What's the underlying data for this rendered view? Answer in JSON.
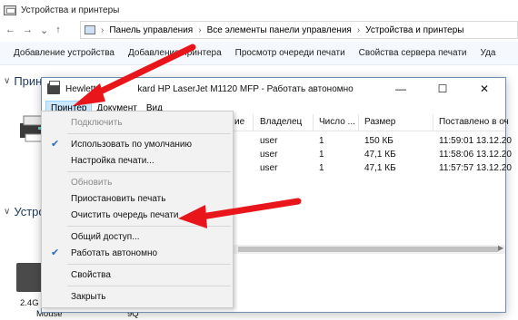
{
  "bg": {
    "title": "Устройства и принтеры",
    "breadcrumb": [
      "Панель управления",
      "Все элементы панели управления",
      "Устройства и принтеры"
    ],
    "toolbar": [
      "Добавление устройства",
      "Добавление принтера",
      "Просмотр очереди печати",
      "Свойства сервера печати",
      "Уда"
    ],
    "section_printers": "Принт",
    "section_devices": "Устро",
    "device1_line1": "2.4G K",
    "device1_line2": "Mouse",
    "device2_line": "9Q"
  },
  "win": {
    "title_a": "Hewlett",
    "title_b": "kard HP LaserJet M1120 MFP  -  Работать автономно",
    "min": "—",
    "max": "☐",
    "close": "✕",
    "menus": [
      "Принтер",
      "Документ",
      "Вид"
    ],
    "columns": [
      "ие",
      "Владелец",
      "Число ...",
      "Размер",
      "Поставлено в оч"
    ],
    "rows": [
      {
        "owner": "user",
        "count": "1",
        "size": "150 КБ",
        "queued": "11:59:01  13.12.20"
      },
      {
        "owner": "user",
        "count": "1",
        "size": "47,1 КБ",
        "queued": "11:58:06  13.12.20"
      },
      {
        "owner": "user",
        "count": "1",
        "size": "47,1 КБ",
        "queued": "11:57:57  13.12.20"
      }
    ]
  },
  "menu": {
    "items": [
      {
        "label": "Подключить",
        "disabled": true,
        "checked": false
      },
      {
        "label": "Использовать по умолчанию",
        "disabled": false,
        "checked": true
      },
      {
        "label": "Настройка печати...",
        "disabled": false,
        "checked": false
      },
      {
        "label": "Обновить",
        "disabled": true,
        "checked": false
      },
      {
        "label": "Приостановить печать",
        "disabled": false,
        "checked": false
      },
      {
        "label": "Очистить очередь печати",
        "disabled": false,
        "checked": false
      },
      {
        "label": "Общий доступ...",
        "disabled": false,
        "checked": false
      },
      {
        "label": "Работать автономно",
        "disabled": false,
        "checked": true
      },
      {
        "label": "Свойства",
        "disabled": false,
        "checked": false
      },
      {
        "label": "Закрыть",
        "disabled": false,
        "checked": false
      }
    ]
  },
  "colors": {
    "arrow": "#e8161b",
    "check": "#2a6fb7",
    "menu_highlight": "#cce8ff"
  }
}
